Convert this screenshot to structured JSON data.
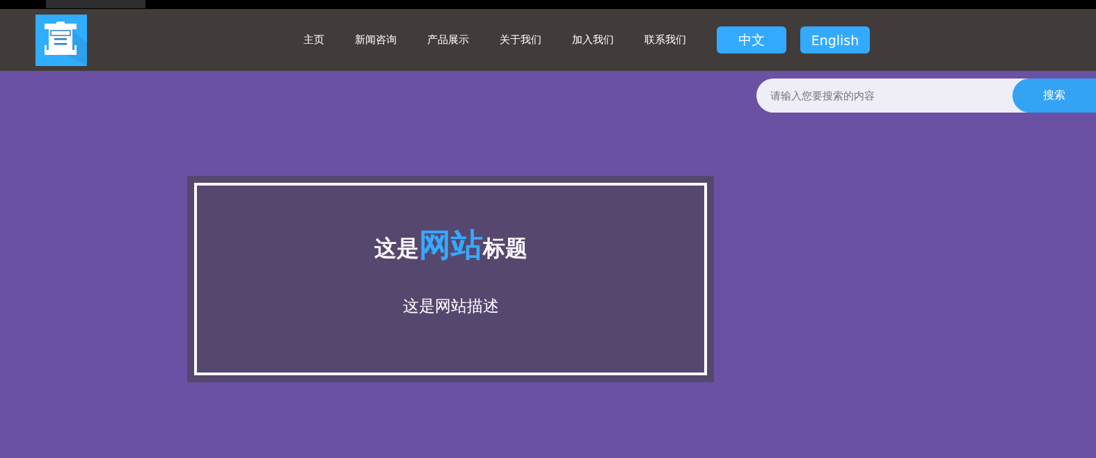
{
  "nav": {
    "items": [
      {
        "label": "主页"
      },
      {
        "label": "新闻咨询"
      },
      {
        "label": "产品展示"
      },
      {
        "label": "关于我们"
      },
      {
        "label": "加入我们"
      },
      {
        "label": "联系我们"
      }
    ],
    "languages": [
      {
        "label": "中文"
      },
      {
        "label": "English"
      }
    ]
  },
  "search": {
    "placeholder": "请输入您要搜索的内容",
    "button": "搜索"
  },
  "hero": {
    "title": [
      {
        "text": "这是",
        "highlight": false
      },
      {
        "text": "网站",
        "highlight": true
      },
      {
        "text": "标题",
        "highlight": false
      }
    ],
    "description": "这是网站描述"
  }
}
